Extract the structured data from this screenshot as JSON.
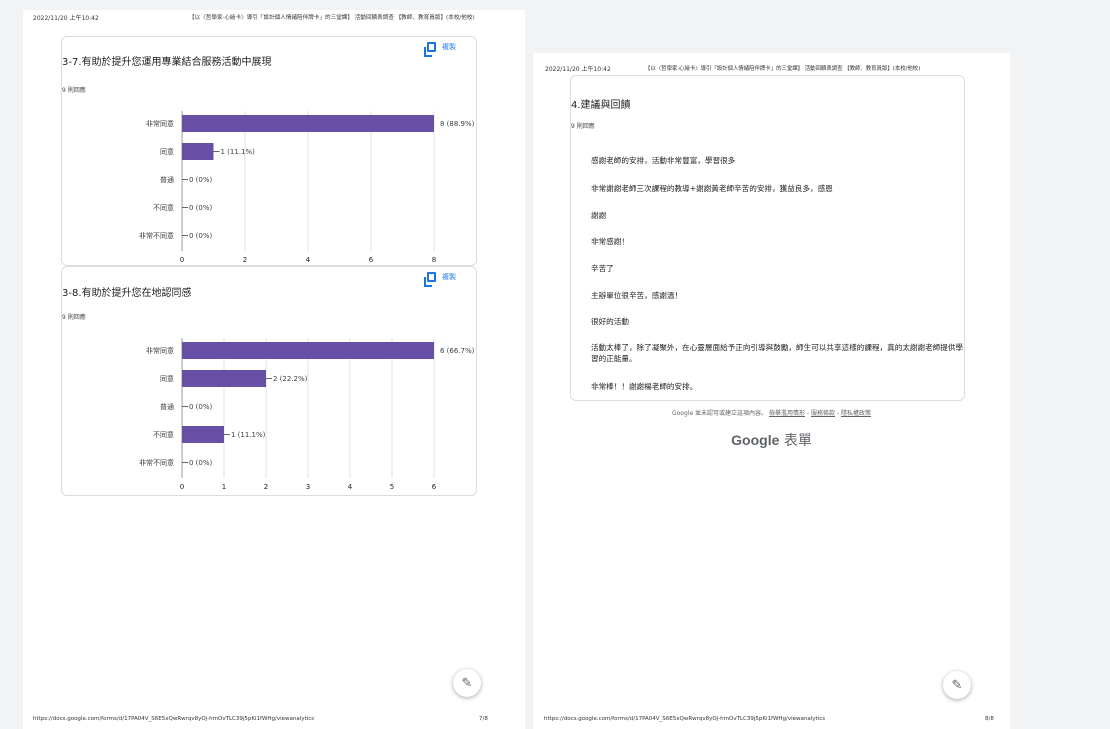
{
  "page1": {
    "header_time": "2022/11/20 上午10:42",
    "header_title": "【以〈哲學家·心繪卡〉導引「設計個人情緒陪伴牌卡」的三堂課】 活動回饋表調查 【教師、教育員版】(本校/他校)",
    "footer_url": "https://docs.google.com/forms/d/17PA04V_S6E5xQwRwrqv8yOj-hmOvTLC39j5pKi1fWHg/viewanalytics",
    "footer_page": "7/8",
    "questions": [
      {
        "title": "3-7.有助於提升您運用專業結合服務活動中展現",
        "responses": "9 則回應",
        "copy_label": "複製",
        "chart_data": {
          "type": "bar",
          "orientation": "horizontal",
          "categories": [
            "非常同意",
            "同意",
            "普通",
            "不同意",
            "非常不同意"
          ],
          "values": [
            8,
            1,
            0,
            0,
            0
          ],
          "value_labels": [
            "8 (88.9%)",
            "1 (11.1%)",
            "0 (0%)",
            "0 (0%)",
            "0 (0%)"
          ],
          "xlim": [
            0,
            8
          ],
          "xticks": [
            0,
            2,
            4,
            6,
            8
          ],
          "grid": true,
          "color": "#674ea7"
        }
      },
      {
        "title": "3-8.有助於提升您在地認同感",
        "responses": "9 則回應",
        "copy_label": "複製",
        "chart_data": {
          "type": "bar",
          "orientation": "horizontal",
          "categories": [
            "非常同意",
            "同意",
            "普通",
            "不同意",
            "非常不同意"
          ],
          "values": [
            6,
            2,
            0,
            1,
            0
          ],
          "value_labels": [
            "6 (66.7%)",
            "2 (22.2%)",
            "0 (0%)",
            "1 (11.1%)",
            "0 (0%)"
          ],
          "xlim": [
            0,
            6
          ],
          "xticks": [
            0,
            1,
            2,
            3,
            4,
            5,
            6
          ],
          "grid": true,
          "color": "#674ea7"
        }
      }
    ],
    "fab_icon": "edit-pencil-icon"
  },
  "page2": {
    "header_time": "2022/11/20 上午10:42",
    "header_title": "【以〈哲學家·心繪卡〉導引「設計個人情緒陪伴牌卡」的三堂課】 活動回饋表調查 【教師、教育員版】(本校/他校)",
    "question_title": "4.建議與回饋",
    "responses": "9 則回應",
    "answers": [
      "感謝老師的安排，活動非常豐富，學習很多",
      "非常謝謝老師三次課程的教導+謝謝黃老師辛苦的安排，獲益良多，感恩",
      "謝謝",
      "非常感謝！",
      "辛苦了",
      "主辦單位很辛苦，感謝溫！",
      "很好的活動",
      "活動太棒了，除了凝聚外，在心靈層面給予正向引導與鼓勵，師生可以共享這樣的課程，真的太謝謝老師提供學習的正能量。",
      "非常棒！！謝謝楊老師的安排。"
    ],
    "google_note": "Google 並未認可或建立這項內容。",
    "links": [
      "檢舉濫用情形",
      "服務條款",
      "隱私權政策"
    ],
    "brand_google": "Google",
    "brand_forms": "表單",
    "footer_url": "https://docs.google.com/forms/d/17PA04V_S6E5xQwRwrqv8yOj-hmOvTLC39j5pKi1fWHg/viewanalytics",
    "footer_page": "8/8",
    "fab_icon": "edit-pencil-icon"
  }
}
